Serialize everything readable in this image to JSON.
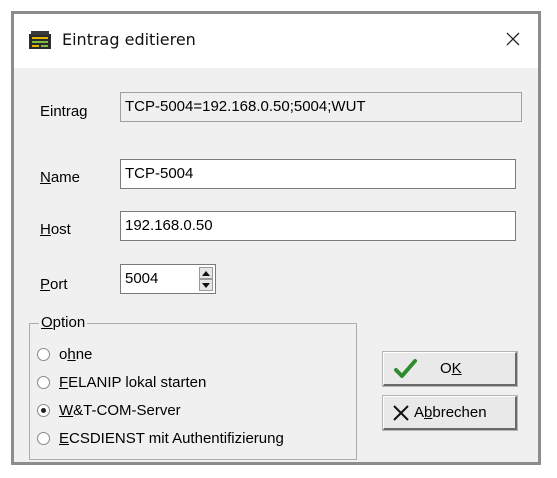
{
  "window": {
    "title": "Eintrag editieren",
    "close_glyph": "✕"
  },
  "entry": {
    "label": "Eintrag",
    "value": "TCP-5004=192.168.0.50;5004;WUT"
  },
  "name": {
    "label_prefix": "N",
    "label_rest": "ame",
    "value": "TCP-5004"
  },
  "host": {
    "label_prefix": "H",
    "label_rest": "ost",
    "value": "192.168.0.50"
  },
  "port": {
    "label_prefix": "P",
    "label_rest": "ort",
    "value": "5004"
  },
  "option": {
    "legend_prefix": "O",
    "legend_rest": "ption",
    "radios": [
      {
        "pre": "o",
        "key": "h",
        "post": "ne",
        "checked": false
      },
      {
        "pre": "",
        "key": "F",
        "post": "ELANIP lokal starten",
        "checked": false
      },
      {
        "pre": "",
        "key": "W",
        "post": "&T-COM-Server",
        "checked": true
      },
      {
        "pre": "",
        "key": "E",
        "post": "CSDIENST mit Authentifizierung",
        "checked": false
      }
    ]
  },
  "buttons": {
    "ok": {
      "pre": "O",
      "key": "K",
      "post": "",
      "icon": "checkmark-icon",
      "icon_color": "#2e8b2e"
    },
    "cancel": {
      "pre": "A",
      "key": "b",
      "post": "brechen",
      "icon": "x-icon"
    }
  }
}
